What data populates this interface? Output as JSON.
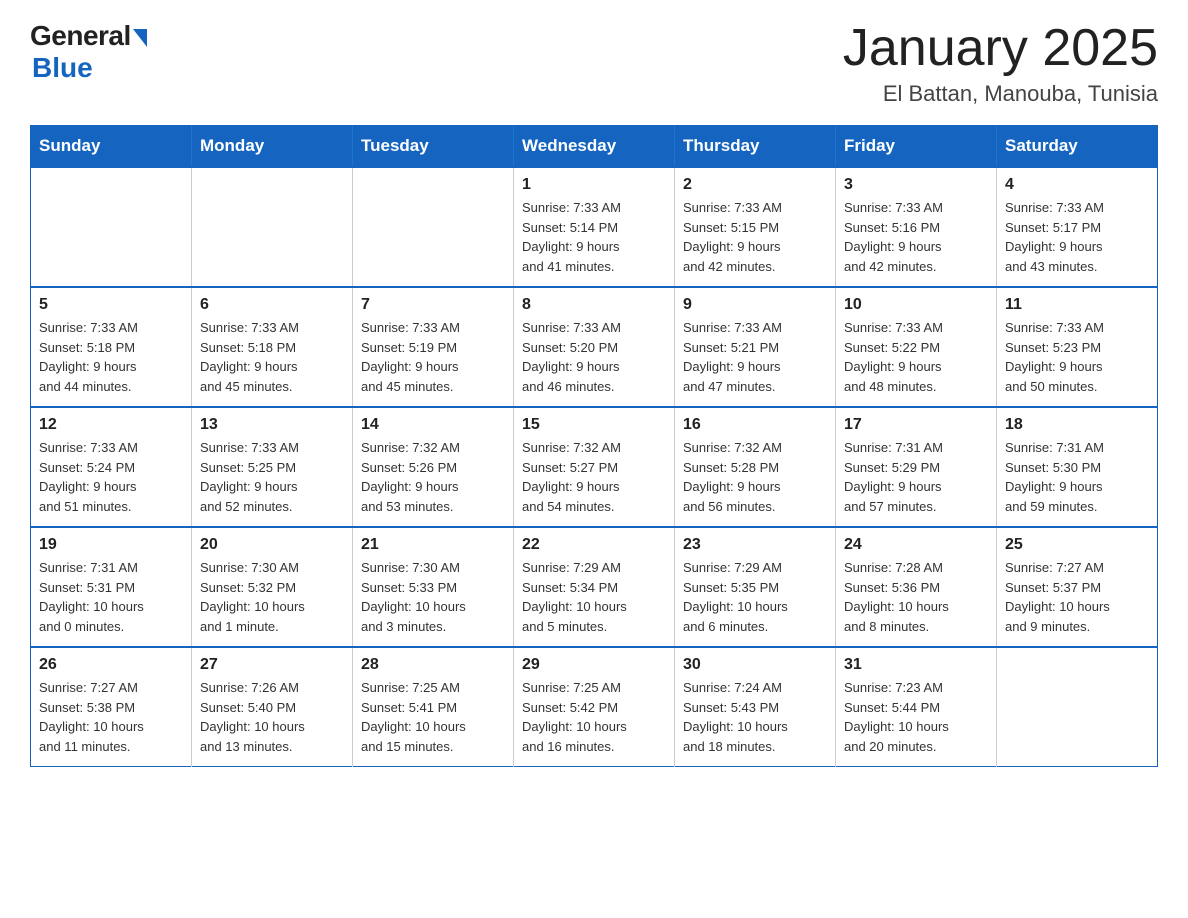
{
  "logo": {
    "general": "General",
    "blue": "Blue"
  },
  "title": "January 2025",
  "subtitle": "El Battan, Manouba, Tunisia",
  "days_of_week": [
    "Sunday",
    "Monday",
    "Tuesday",
    "Wednesday",
    "Thursday",
    "Friday",
    "Saturday"
  ],
  "weeks": [
    [
      {
        "day": "",
        "info": ""
      },
      {
        "day": "",
        "info": ""
      },
      {
        "day": "",
        "info": ""
      },
      {
        "day": "1",
        "info": "Sunrise: 7:33 AM\nSunset: 5:14 PM\nDaylight: 9 hours\nand 41 minutes."
      },
      {
        "day": "2",
        "info": "Sunrise: 7:33 AM\nSunset: 5:15 PM\nDaylight: 9 hours\nand 42 minutes."
      },
      {
        "day": "3",
        "info": "Sunrise: 7:33 AM\nSunset: 5:16 PM\nDaylight: 9 hours\nand 42 minutes."
      },
      {
        "day": "4",
        "info": "Sunrise: 7:33 AM\nSunset: 5:17 PM\nDaylight: 9 hours\nand 43 minutes."
      }
    ],
    [
      {
        "day": "5",
        "info": "Sunrise: 7:33 AM\nSunset: 5:18 PM\nDaylight: 9 hours\nand 44 minutes."
      },
      {
        "day": "6",
        "info": "Sunrise: 7:33 AM\nSunset: 5:18 PM\nDaylight: 9 hours\nand 45 minutes."
      },
      {
        "day": "7",
        "info": "Sunrise: 7:33 AM\nSunset: 5:19 PM\nDaylight: 9 hours\nand 45 minutes."
      },
      {
        "day": "8",
        "info": "Sunrise: 7:33 AM\nSunset: 5:20 PM\nDaylight: 9 hours\nand 46 minutes."
      },
      {
        "day": "9",
        "info": "Sunrise: 7:33 AM\nSunset: 5:21 PM\nDaylight: 9 hours\nand 47 minutes."
      },
      {
        "day": "10",
        "info": "Sunrise: 7:33 AM\nSunset: 5:22 PM\nDaylight: 9 hours\nand 48 minutes."
      },
      {
        "day": "11",
        "info": "Sunrise: 7:33 AM\nSunset: 5:23 PM\nDaylight: 9 hours\nand 50 minutes."
      }
    ],
    [
      {
        "day": "12",
        "info": "Sunrise: 7:33 AM\nSunset: 5:24 PM\nDaylight: 9 hours\nand 51 minutes."
      },
      {
        "day": "13",
        "info": "Sunrise: 7:33 AM\nSunset: 5:25 PM\nDaylight: 9 hours\nand 52 minutes."
      },
      {
        "day": "14",
        "info": "Sunrise: 7:32 AM\nSunset: 5:26 PM\nDaylight: 9 hours\nand 53 minutes."
      },
      {
        "day": "15",
        "info": "Sunrise: 7:32 AM\nSunset: 5:27 PM\nDaylight: 9 hours\nand 54 minutes."
      },
      {
        "day": "16",
        "info": "Sunrise: 7:32 AM\nSunset: 5:28 PM\nDaylight: 9 hours\nand 56 minutes."
      },
      {
        "day": "17",
        "info": "Sunrise: 7:31 AM\nSunset: 5:29 PM\nDaylight: 9 hours\nand 57 minutes."
      },
      {
        "day": "18",
        "info": "Sunrise: 7:31 AM\nSunset: 5:30 PM\nDaylight: 9 hours\nand 59 minutes."
      }
    ],
    [
      {
        "day": "19",
        "info": "Sunrise: 7:31 AM\nSunset: 5:31 PM\nDaylight: 10 hours\nand 0 minutes."
      },
      {
        "day": "20",
        "info": "Sunrise: 7:30 AM\nSunset: 5:32 PM\nDaylight: 10 hours\nand 1 minute."
      },
      {
        "day": "21",
        "info": "Sunrise: 7:30 AM\nSunset: 5:33 PM\nDaylight: 10 hours\nand 3 minutes."
      },
      {
        "day": "22",
        "info": "Sunrise: 7:29 AM\nSunset: 5:34 PM\nDaylight: 10 hours\nand 5 minutes."
      },
      {
        "day": "23",
        "info": "Sunrise: 7:29 AM\nSunset: 5:35 PM\nDaylight: 10 hours\nand 6 minutes."
      },
      {
        "day": "24",
        "info": "Sunrise: 7:28 AM\nSunset: 5:36 PM\nDaylight: 10 hours\nand 8 minutes."
      },
      {
        "day": "25",
        "info": "Sunrise: 7:27 AM\nSunset: 5:37 PM\nDaylight: 10 hours\nand 9 minutes."
      }
    ],
    [
      {
        "day": "26",
        "info": "Sunrise: 7:27 AM\nSunset: 5:38 PM\nDaylight: 10 hours\nand 11 minutes."
      },
      {
        "day": "27",
        "info": "Sunrise: 7:26 AM\nSunset: 5:40 PM\nDaylight: 10 hours\nand 13 minutes."
      },
      {
        "day": "28",
        "info": "Sunrise: 7:25 AM\nSunset: 5:41 PM\nDaylight: 10 hours\nand 15 minutes."
      },
      {
        "day": "29",
        "info": "Sunrise: 7:25 AM\nSunset: 5:42 PM\nDaylight: 10 hours\nand 16 minutes."
      },
      {
        "day": "30",
        "info": "Sunrise: 7:24 AM\nSunset: 5:43 PM\nDaylight: 10 hours\nand 18 minutes."
      },
      {
        "day": "31",
        "info": "Sunrise: 7:23 AM\nSunset: 5:44 PM\nDaylight: 10 hours\nand 20 minutes."
      },
      {
        "day": "",
        "info": ""
      }
    ]
  ]
}
